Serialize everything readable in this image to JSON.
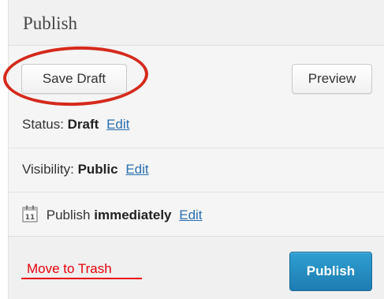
{
  "header": {
    "title": "Publish"
  },
  "actions": {
    "save_draft_label": "Save Draft",
    "preview_label": "Preview"
  },
  "status": {
    "prefix": "Status:",
    "value": "Draft",
    "edit_label": "Edit"
  },
  "visibility": {
    "prefix": "Visibility:",
    "value": "Public",
    "edit_label": "Edit"
  },
  "schedule": {
    "prefix": "Publish",
    "value": "immediately",
    "edit_label": "Edit",
    "calendar_day": "11",
    "icon": "calendar-icon"
  },
  "footer": {
    "trash_label": "Move to Trash",
    "publish_label": "Publish"
  },
  "colors": {
    "publish_button": "#2089c0",
    "link": "#2a6fb0",
    "trash": "#e8000a",
    "highlight_circle": "#d5291c"
  }
}
